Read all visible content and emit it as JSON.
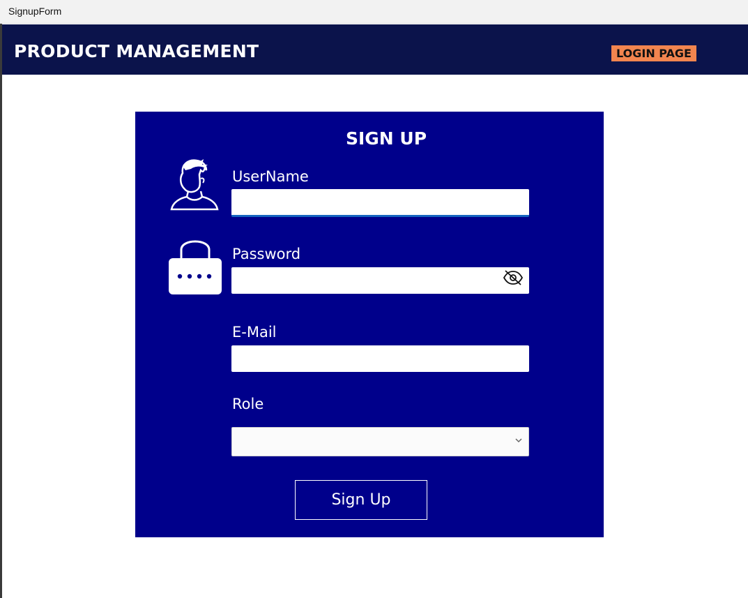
{
  "window": {
    "title": "SignupForm"
  },
  "header": {
    "app_title": "PRODUCT MANAGEMENT",
    "login_button": "LOGIN PAGE",
    "background_color": "#0b134b",
    "login_button_color": "#f2854f"
  },
  "form": {
    "title": "SIGN UP",
    "background_color": "#00008b",
    "username": {
      "label": "UserName",
      "value": "",
      "icon": "user-avatar-icon"
    },
    "password": {
      "label": "Password",
      "value": "",
      "icon": "lock-icon",
      "toggle_icon": "eye-slash-icon"
    },
    "email": {
      "label": "E-Mail",
      "value": ""
    },
    "role": {
      "label": "Role",
      "selected": "",
      "icon": "chevron-down-icon"
    },
    "submit_label": "Sign Up"
  }
}
